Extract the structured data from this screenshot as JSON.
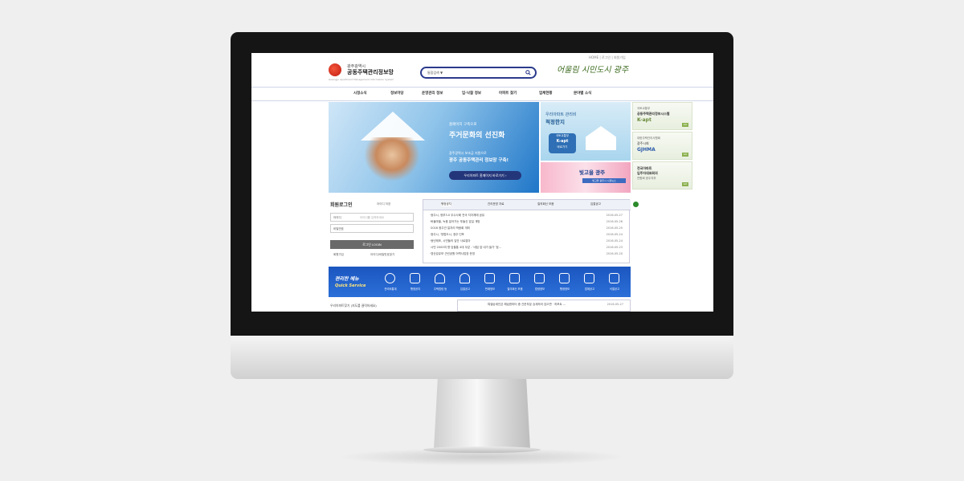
{
  "top_links": "HOME | 로그인 | 회원가입",
  "logo": {
    "city": "광주광역시",
    "name": "공동주택관리정보망",
    "en": "Gwangju Apartment Management Information System"
  },
  "search": {
    "category": "통합검색 ▼"
  },
  "slogan": "어울림 시민도시 광주",
  "nav": [
    "시정소식",
    "정보마당",
    "운영관리 정보",
    "입·낙찰 정보",
    "아파트 찾기",
    "업체현황",
    "분야별 소식"
  ],
  "hero": {
    "line1": "홈페이지 구축으로",
    "line2": "주거문화의 선진화",
    "line3": "광주광역시 보조금 지원으로",
    "line4": "광주 공동주택관리 정보망 구축!",
    "button": "우리아파트 홈페이지 바로가기 ›"
  },
  "kapt_banner": {
    "line1": "우리아파트 관리비",
    "line2": "적정한지",
    "line2b": "궁금하세요?",
    "badge1": "국토교통부",
    "badge2": "K-apt",
    "badge3": "바로가기"
  },
  "spring_banner": {
    "title": "빛고을 광주",
    "sub": "빛고을 광주시 시정뉴스"
  },
  "side_banners": [
    {
      "l1": "국토교통부",
      "l2": "공동주택관리정보시스템",
      "l3": "K-apt",
      "go": "GO"
    },
    {
      "l1": "",
      "l2": "대한주택관리사협회",
      "l3": "광주시회",
      "l4": "GJHMA",
      "go": "GO"
    },
    {
      "l1": "",
      "l2": "전국아파트",
      "l3": "입주자대표회의",
      "l4": "연합회 광주지부",
      "go": "GO"
    }
  ],
  "login": {
    "title": "회원로그인",
    "save": "아이디 저장",
    "id_label": "아이디",
    "id_placeholder": "아이디를 입력하세요",
    "pw_label": "비밀번호",
    "button": "로그인 LOGIN",
    "join": "회원가입",
    "find": "아이디/비밀번호찾기"
  },
  "notice": {
    "tabs": [
      "행정공지",
      "관리운영 자료",
      "질의회신 모음",
      "입찰공고"
    ],
    "items": [
      {
        "title": "·광주시, 정부3.0 우수사례 전국 지자체에 공유",
        "date": "2016-05-27"
      },
      {
        "title": "·버들마을, 녹음 짙어가는 푸들신 앞길 개방",
        "date": "2016-05-26"
      },
      {
        "title": "·2016 광주관 일자리 박람회 개최",
        "date": "2016-05-25"
      },
      {
        "title": "·광주시, '방법도시, 광주'선포",
        "date": "2016-05-24"
      },
      {
        "title": "·쌍년제조, 시민들의 입안 사로잡아",
        "date": "2016-05-24"
      },
      {
        "title": "·시민 2000여 명 담을통 4대 우갚 - '내집 앞 내가 쓸기' 범...",
        "date": "2016-05-23"
      },
      {
        "title": "·영산강유보 근린공원 어쩍사업장 운영",
        "date": "2016-05-20"
      }
    ]
  },
  "quick": {
    "title": "편리한 메뉴",
    "sub": "Quick Service",
    "items": [
      "관리비통계",
      "행정공지",
      "주택법령 등",
      "입찰공고",
      "판례정보",
      "질의회신 모음",
      "법령정보",
      "행정정보",
      "업체공고",
      "낙찰공고"
    ]
  },
  "bottom": {
    "left": "우리아파트찾기 (지도를 클릭하세요)",
    "right_title": "·특별승계인은 해납한마터 중 간운부분 승계하라 않으면 · 하포트 ...",
    "right_date": "2016-05-27"
  }
}
